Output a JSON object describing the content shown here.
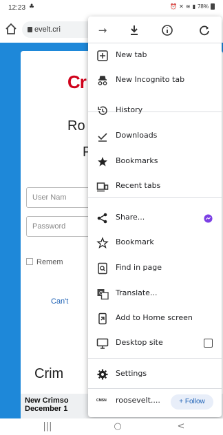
{
  "status_bar": {
    "time": "12:23",
    "battery": "78%"
  },
  "browser": {
    "url_fragment": "evelt.cri"
  },
  "page": {
    "logo_text": "Cr",
    "title_line_1": "Ro",
    "title_line_2": "P",
    "username_placeholder": "User Nam",
    "password_placeholder": "Password",
    "remember_label": "Remem",
    "cant_link": "Can't",
    "heading": "Crim",
    "news_text": "New Crimso December 1"
  },
  "menu": {
    "top_icons": [
      "forward-icon",
      "download-icon",
      "info-icon",
      "refresh-icon"
    ],
    "items": [
      {
        "label": "New tab",
        "icon": "new-tab-icon"
      },
      {
        "label": "New Incognito tab",
        "icon": "incognito-icon"
      },
      {
        "label": "History",
        "icon": "history-icon"
      },
      {
        "label": "Downloads",
        "icon": "downloads-icon"
      },
      {
        "label": "Bookmarks",
        "icon": "bookmarks-icon"
      },
      {
        "label": "Recent tabs",
        "icon": "recent-tabs-icon"
      },
      {
        "label": "Share...",
        "icon": "share-icon"
      },
      {
        "label": "Bookmark",
        "icon": "bookmark-star-icon"
      },
      {
        "label": "Find in page",
        "icon": "find-in-page-icon"
      },
      {
        "label": "Translate...",
        "icon": "translate-icon"
      },
      {
        "label": "Add to Home screen",
        "icon": "add-to-home-icon"
      },
      {
        "label": "Desktop site",
        "icon": "desktop-icon"
      },
      {
        "label": "Settings",
        "icon": "settings-icon"
      }
    ],
    "site_label": "roosevelt....",
    "follow_label": "+ Follow"
  },
  "navbar": {
    "recents": "|||",
    "home": "○",
    "back": "<"
  },
  "colors": {
    "page_blue": "#1e88d9",
    "logo_red": "#d0021b",
    "follow_blue": "#1a5fb4",
    "messenger_purple": "#7b3fe4"
  }
}
